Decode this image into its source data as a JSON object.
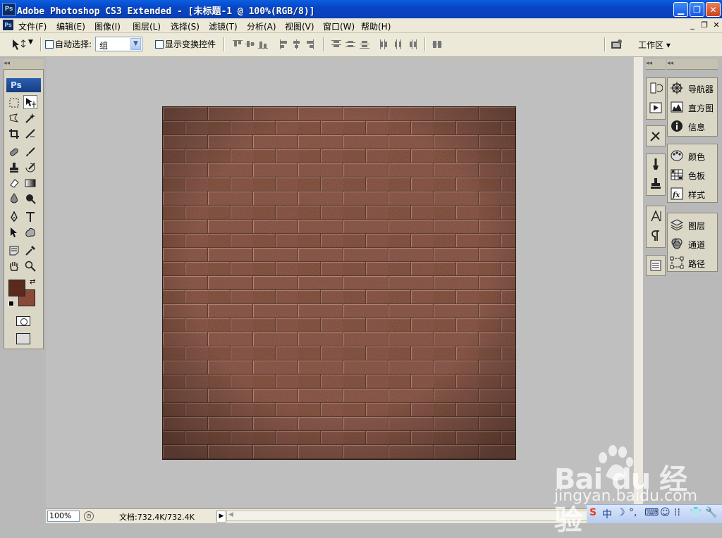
{
  "window": {
    "title": "Adobe Photoshop CS3 Extended - [未标题-1 @ 100%(RGB/8)]",
    "app_icon": "Ps",
    "controls": [
      "minimize-icon",
      "restore-icon",
      "close-icon"
    ]
  },
  "menubar": {
    "items": [
      "文件(F)",
      "编辑(E)",
      "图像(I)",
      "图层(L)",
      "选择(S)",
      "滤镜(T)",
      "分析(A)",
      "视图(V)",
      "窗口(W)",
      "帮助(H)"
    ]
  },
  "options": {
    "auto_select_label": "自动选择:",
    "auto_select_value": "组",
    "show_transform_label": "显示变换控件",
    "workspace_label": "工作区 ▾"
  },
  "tools": {
    "logo": "Ps",
    "foreground_color": "#5c2a1d",
    "background_color": "#8a4a3a"
  },
  "panels": {
    "group1": [
      "导航器",
      "直方图",
      "信息"
    ],
    "group2": [
      "颜色",
      "色板",
      "样式"
    ],
    "group3": [
      "图层",
      "通道",
      "路径"
    ]
  },
  "canvas": {
    "texture": "brick-wall",
    "brick_color": "#7a4536",
    "mortar_color": "#b47c68"
  },
  "status": {
    "zoom": "100%",
    "doc_info": "文档:732.4K/732.4K"
  },
  "watermark": {
    "logo": "Bai du 经验",
    "url": "jingyan.baidu.com"
  },
  "tray": {
    "ime_label": "中"
  }
}
